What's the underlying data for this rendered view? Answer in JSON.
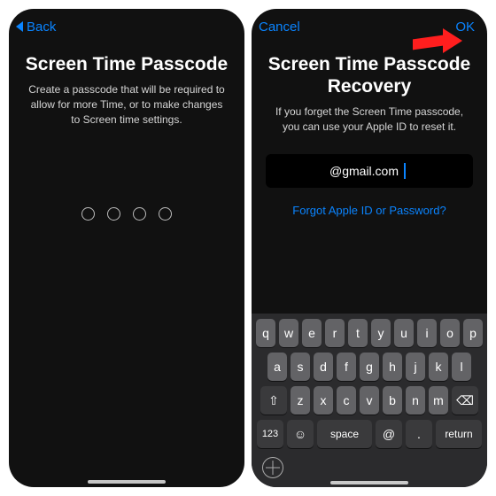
{
  "left": {
    "nav": {
      "back": "Back"
    },
    "title": "Screen Time Passcode",
    "subtitle": "Create a passcode that will be required to allow for more Time, or to make changes to Screen time settings."
  },
  "right": {
    "nav": {
      "cancel": "Cancel",
      "ok": "OK"
    },
    "title": "Screen Time Passcode Recovery",
    "subtitle": "If you forget the Screen Time passcode, you can use your Apple ID to reset it.",
    "email_visible": "@gmail.com",
    "forgot": "Forgot Apple ID or Password?",
    "keyboard": {
      "row1": [
        "q",
        "w",
        "e",
        "r",
        "t",
        "y",
        "u",
        "i",
        "o",
        "p"
      ],
      "row2": [
        "a",
        "s",
        "d",
        "f",
        "g",
        "h",
        "j",
        "k",
        "l"
      ],
      "row3": [
        "z",
        "x",
        "c",
        "v",
        "b",
        "n",
        "m"
      ],
      "shift": "⇧",
      "backspace": "⌫",
      "numbers": "123",
      "emoji": "☺",
      "space": "space",
      "at": "@",
      "dot": ".",
      "return": "return"
    }
  }
}
